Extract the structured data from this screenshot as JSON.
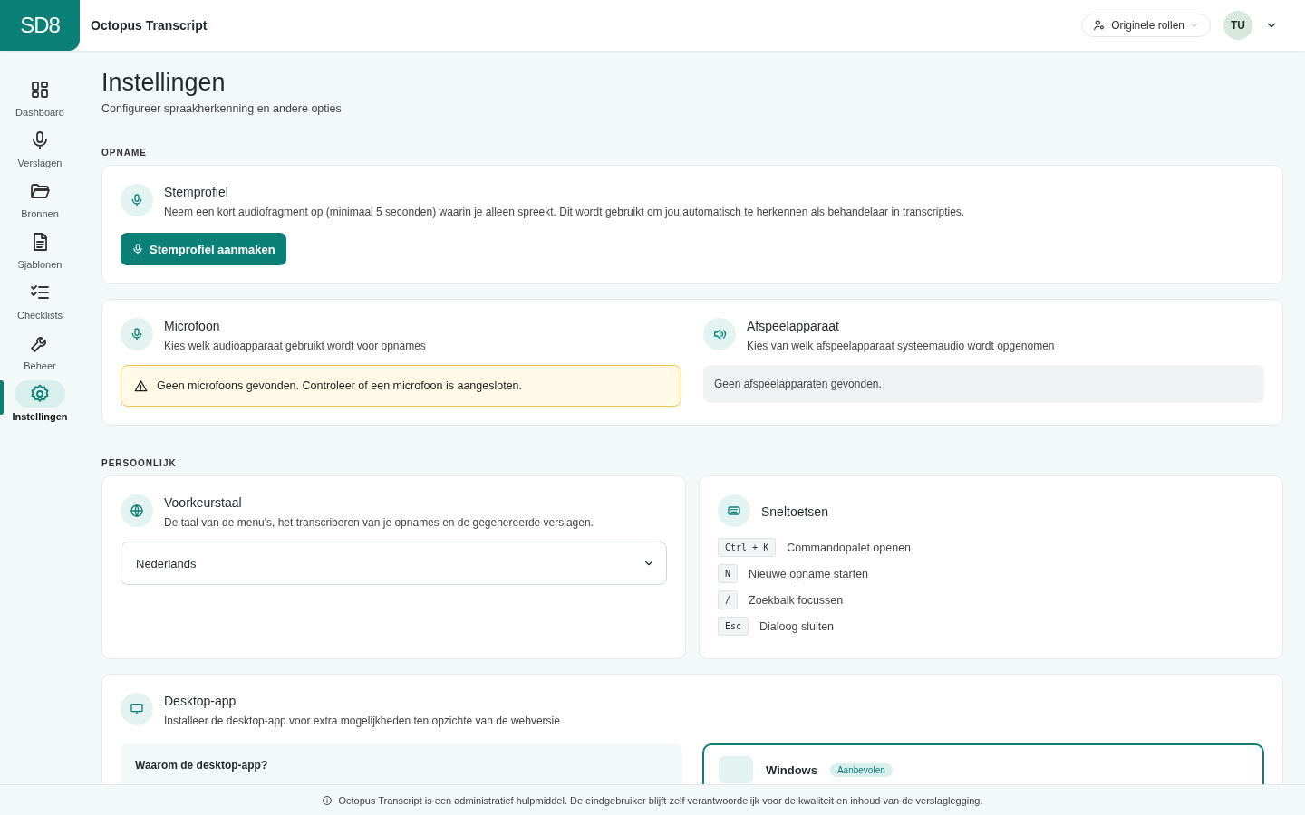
{
  "header": {
    "logo": "SD8",
    "app_name": "Octopus Transcript",
    "role_button": "Originele rollen",
    "avatar": "TU"
  },
  "sidebar": {
    "items": [
      {
        "label": "Dashboard",
        "selected": false
      },
      {
        "label": "Verslagen",
        "selected": false
      },
      {
        "label": "Bronnen",
        "selected": false
      },
      {
        "label": "Sjablonen",
        "selected": false
      },
      {
        "label": "Checklists",
        "selected": false
      },
      {
        "label": "Beheer",
        "selected": false
      },
      {
        "label": "Instellingen",
        "selected": true
      }
    ]
  },
  "page": {
    "title": "Instellingen",
    "subtitle": "Configureer spraakherkenning en andere opties"
  },
  "sections": [
    {
      "heading": "OPNAME"
    },
    {
      "heading": "PERSOONLIJK"
    }
  ],
  "voice_profile": {
    "title": "Stemprofiel",
    "description": "Neem een kort audiofragment op (minimaal 5 seconden) waarin je alleen spreekt. Dit wordt gebruikt om jou automatisch te herkennen als behandelaar in transcripties.",
    "button": "Stemprofiel aanmaken"
  },
  "devices": [
    {
      "title": "Microfoon",
      "description": "Kies welk audioapparaat gebruikt wordt voor opnames",
      "notice": {
        "kind": "warning",
        "text": "Geen microfoons gevonden. Controleer of een microfoon is aangesloten."
      }
    },
    {
      "title": "Afspeelapparaat",
      "description": "Kies van welk afspeelapparaat systeemaudio wordt opgenomen",
      "notice": {
        "kind": "empty",
        "text": "Geen afspeelapparaten gevonden."
      }
    }
  ],
  "language": {
    "title": "Voorkeurstaal",
    "description": "De taal van de menu's, het transcriberen van je opnames en de gegenereerde verslagen.",
    "value": "Nederlands"
  },
  "shortcuts": {
    "title": "Sneltoetsen",
    "items": [
      {
        "key": "Ctrl + K",
        "label": "Commandopalet openen"
      },
      {
        "key": "N",
        "label": "Nieuwe opname starten"
      },
      {
        "key": "/",
        "label": "Zoekbalk focussen"
      },
      {
        "key": "Esc",
        "label": "Dialoog sluiten"
      }
    ]
  },
  "desktop_app": {
    "title": "Desktop-app",
    "description": "Installeer de desktop-app voor extra mogelijkheden ten opzichte van de webversie",
    "why_heading": "Waarom de desktop-app?",
    "platform": "Windows",
    "badge": "Aanbevolen"
  },
  "footer": "Octopus Transcript is een administratief hulpmiddel. De eindgebruiker blijft zelf verantwoordelijk voor de kwaliteit en inhoud van de verslaglegging."
}
